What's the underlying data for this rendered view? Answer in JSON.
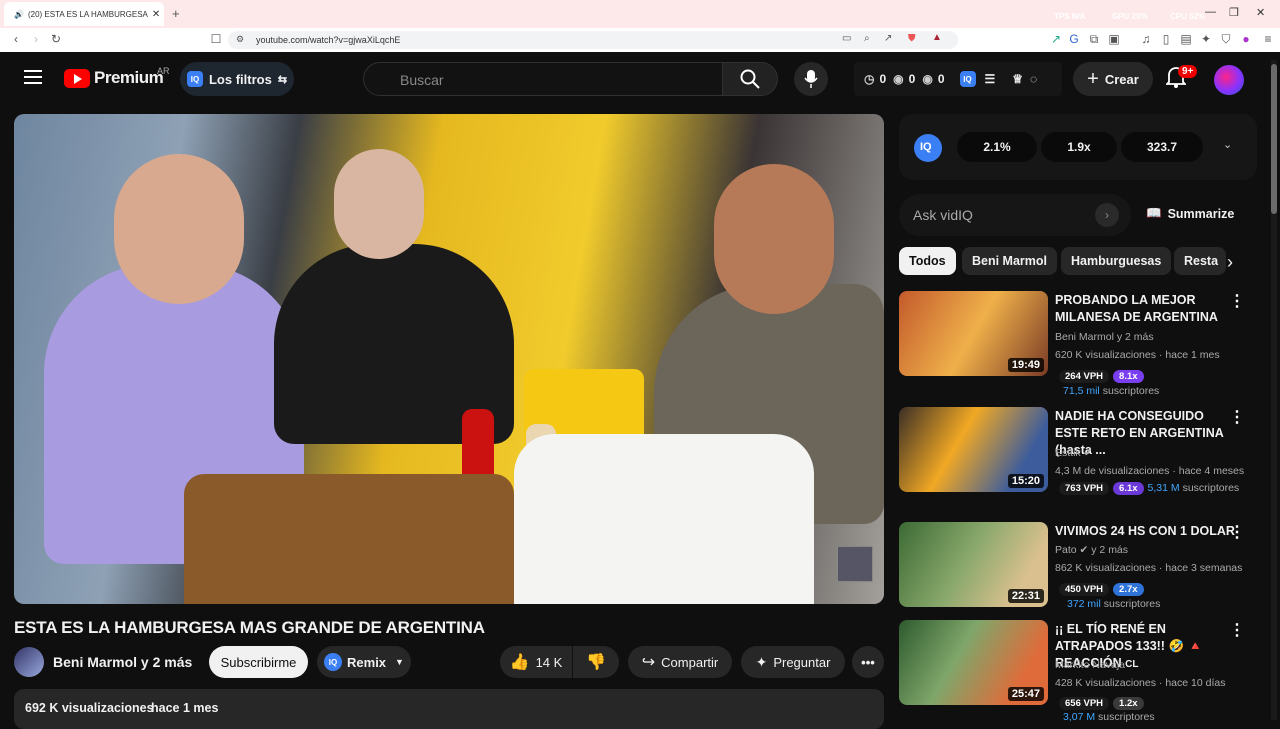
{
  "browser": {
    "tab_title": "(20) ESTA ES LA HAMBURGESA",
    "url": "youtube.com/watch?v=gjwaXiLqchE",
    "perf": {
      "tps": "TPS N/A",
      "gpu": "GPU 20%",
      "cpu": "CPU 52%"
    }
  },
  "header": {
    "logo_text": "Premium",
    "region": "AR",
    "filters_label": "Los filtros",
    "search_placeholder": "Buscar",
    "stats": [
      "0",
      "0",
      "0"
    ],
    "create_label": "Crear",
    "notif_count": "9+"
  },
  "video": {
    "title": "ESTA ES LA HAMBURGESA MAS GRANDE DE ARGENTINA",
    "channel": "Beni Marmol y 2 más",
    "subscribe_label": "Subscribirme",
    "remix_label": "Remix",
    "likes": "14 K",
    "share_label": "Compartir",
    "ask_label": "Preguntar",
    "views": "692 K visualizaciones",
    "age": "hace 1 mes"
  },
  "vidiq": {
    "metrics": [
      "2.1%",
      "1.9x",
      "323.7"
    ],
    "ask_placeholder": "Ask vidIQ",
    "summarize_label": "Summarize"
  },
  "chips": [
    "Todos",
    "Beni Marmol",
    "Hamburguesas",
    "Resta"
  ],
  "related": [
    {
      "title": "PROBANDO LA MEJOR MILANESA DE ARGENTINA",
      "channel": "Beni Marmol y 2 más",
      "views": "620 K visualizaciones",
      "age": "hace 1 mes",
      "duration": "19:49",
      "vph": "264 VPH",
      "mult": "8.1x",
      "subs_value": "71,5 mil",
      "subs_label": "suscriptores",
      "mult_color": "#7b3ff2"
    },
    {
      "title": "NADIE HA CONSEGUIDO ESTE RETO EN ARGENTINA (hasta ...",
      "channel": "Esttik",
      "views": "4,3 M de visualizaciones",
      "age": "hace 4 meses",
      "duration": "15:20",
      "vph": "763 VPH",
      "mult": "6.1x",
      "subs_value": "5,31 M",
      "subs_label": "suscriptores",
      "mult_color": "#6a39d8"
    },
    {
      "title": "VIVIMOS 24 HS CON 1 DOLAR",
      "channel": "Pato",
      "channel_suffix": "y 2 más",
      "views": "862 K visualizaciones",
      "age": "hace 3 semanas",
      "duration": "22:31",
      "vph": "450 VPH",
      "mult": "2.7x",
      "subs_value": "372 mil",
      "subs_label": "suscriptores",
      "mult_color": "#2f73d9"
    },
    {
      "title": "¡¡ EL TÍO RENÉ EN ATRAPADOS 133!! 🤣 🔺 REACCIÓN",
      "title_suffix": "CL",
      "channel": "Markito Navaja",
      "views": "428 K visualizaciones",
      "age": "hace 10 días",
      "duration": "25:47",
      "vph": "656 VPH",
      "mult": "1.2x",
      "subs_value": "3,07 M",
      "subs_label": "suscriptores",
      "mult_color": "#3a3a3a"
    }
  ]
}
